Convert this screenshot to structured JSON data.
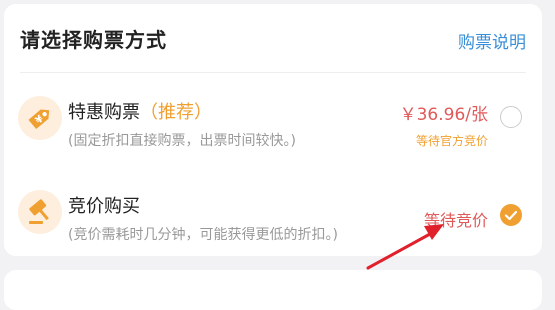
{
  "header": {
    "title": "请选择购票方式",
    "link": "购票说明"
  },
  "options": [
    {
      "icon": "discount-tag-icon",
      "title": "特惠购票",
      "tag": "（推荐）",
      "desc": "(固定折扣直接购票，出票时间较快。)",
      "price": "￥36.96/张",
      "price_sub": "等待官方竞价",
      "selected": false
    },
    {
      "icon": "auction-hammer-icon",
      "title": "竞价购买",
      "desc": "(竞价需耗时几分钟，可能获得更低的折扣。)",
      "status": "等待竞价",
      "selected": true
    }
  ],
  "colors": {
    "accent": "#f0a030",
    "price_red": "#e05a5a",
    "link_blue": "#3a8fd8",
    "annotation_arrow": "#e0202a"
  }
}
